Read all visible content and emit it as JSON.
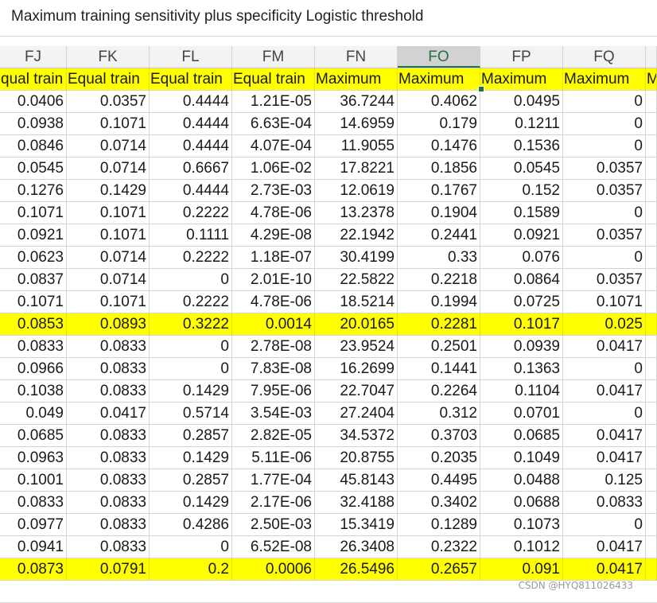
{
  "formula_bar": {
    "text": "Maximum training sensitivity plus specificity Logistic threshold"
  },
  "columns": [
    {
      "label": "FJ"
    },
    {
      "label": "FK"
    },
    {
      "label": "FL"
    },
    {
      "label": "FM"
    },
    {
      "label": "FN"
    },
    {
      "label": "FO",
      "selected": true
    },
    {
      "label": "FP"
    },
    {
      "label": "FQ"
    },
    {
      "label": ""
    }
  ],
  "header_row": [
    "qual train",
    "Equal train",
    "Equal train",
    "Equal train",
    "Maximum",
    "Maximum",
    "Maximum",
    "Maximum",
    "M"
  ],
  "rows": [
    {
      "cells": [
        "0.0406",
        "0.0357",
        "0.4444",
        "1.21E-05",
        "36.7244",
        "0.4062",
        "0.0495",
        "0",
        ""
      ]
    },
    {
      "cells": [
        "0.0938",
        "0.1071",
        "0.4444",
        "6.63E-04",
        "14.6959",
        "0.179",
        "0.1211",
        "0",
        ""
      ]
    },
    {
      "cells": [
        "0.0846",
        "0.0714",
        "0.4444",
        "4.07E-04",
        "11.9055",
        "0.1476",
        "0.1536",
        "0",
        ""
      ]
    },
    {
      "cells": [
        "0.0545",
        "0.0714",
        "0.6667",
        "1.06E-02",
        "17.8221",
        "0.1856",
        "0.0545",
        "0.0357",
        ""
      ]
    },
    {
      "cells": [
        "0.1276",
        "0.1429",
        "0.4444",
        "2.73E-03",
        "12.0619",
        "0.1767",
        "0.152",
        "0.0357",
        ""
      ]
    },
    {
      "cells": [
        "0.1071",
        "0.1071",
        "0.2222",
        "4.78E-06",
        "13.2378",
        "0.1904",
        "0.1589",
        "0",
        ""
      ]
    },
    {
      "cells": [
        "0.0921",
        "0.1071",
        "0.1111",
        "4.29E-08",
        "22.1942",
        "0.2441",
        "0.0921",
        "0.0357",
        ""
      ]
    },
    {
      "cells": [
        "0.0623",
        "0.0714",
        "0.2222",
        "1.18E-07",
        "30.4199",
        "0.33",
        "0.076",
        "0",
        ""
      ]
    },
    {
      "cells": [
        "0.0837",
        "0.0714",
        "0",
        "2.01E-10",
        "22.5822",
        "0.2218",
        "0.0864",
        "0.0357",
        ""
      ]
    },
    {
      "cells": [
        "0.1071",
        "0.1071",
        "0.2222",
        "4.78E-06",
        "18.5214",
        "0.1994",
        "0.0725",
        "0.1071",
        ""
      ]
    },
    {
      "cells": [
        "0.0853",
        "0.0893",
        "0.3222",
        "0.0014",
        "20.0165",
        "0.2281",
        "0.1017",
        "0.025",
        ""
      ],
      "highlight": true
    },
    {
      "cells": [
        "0.0833",
        "0.0833",
        "0",
        "2.78E-08",
        "23.9524",
        "0.2501",
        "0.0939",
        "0.0417",
        ""
      ]
    },
    {
      "cells": [
        "0.0966",
        "0.0833",
        "0",
        "7.83E-08",
        "16.2699",
        "0.1441",
        "0.1363",
        "0",
        ""
      ]
    },
    {
      "cells": [
        "0.1038",
        "0.0833",
        "0.1429",
        "7.95E-06",
        "22.7047",
        "0.2264",
        "0.1104",
        "0.0417",
        ""
      ]
    },
    {
      "cells": [
        "0.049",
        "0.0417",
        "0.5714",
        "3.54E-03",
        "27.2404",
        "0.312",
        "0.0701",
        "0",
        ""
      ]
    },
    {
      "cells": [
        "0.0685",
        "0.0833",
        "0.2857",
        "2.82E-05",
        "34.5372",
        "0.3703",
        "0.0685",
        "0.0417",
        ""
      ]
    },
    {
      "cells": [
        "0.0963",
        "0.0833",
        "0.1429",
        "5.11E-06",
        "20.8755",
        "0.2035",
        "0.1049",
        "0.0417",
        ""
      ]
    },
    {
      "cells": [
        "0.1001",
        "0.0833",
        "0.2857",
        "1.77E-04",
        "45.8143",
        "0.4495",
        "0.0488",
        "0.125",
        ""
      ]
    },
    {
      "cells": [
        "0.0833",
        "0.0833",
        "0.1429",
        "2.17E-06",
        "32.4188",
        "0.3402",
        "0.0688",
        "0.0833",
        ""
      ]
    },
    {
      "cells": [
        "0.0977",
        "0.0833",
        "0.4286",
        "2.50E-03",
        "15.3419",
        "0.1289",
        "0.1073",
        "0",
        ""
      ]
    },
    {
      "cells": [
        "0.0941",
        "0.0833",
        "0",
        "6.52E-08",
        "26.3408",
        "0.2322",
        "0.1012",
        "0.0417",
        ""
      ]
    },
    {
      "cells": [
        "0.0873",
        "0.0791",
        "0.2",
        "0.0006",
        "26.5496",
        "0.2657",
        "0.091",
        "0.0417",
        ""
      ],
      "highlight": true
    }
  ],
  "watermark": "CSDN @HYQ811026433",
  "colors": {
    "highlight": "#ffff00",
    "selection": "#217346",
    "active_text": "#e0204a"
  }
}
